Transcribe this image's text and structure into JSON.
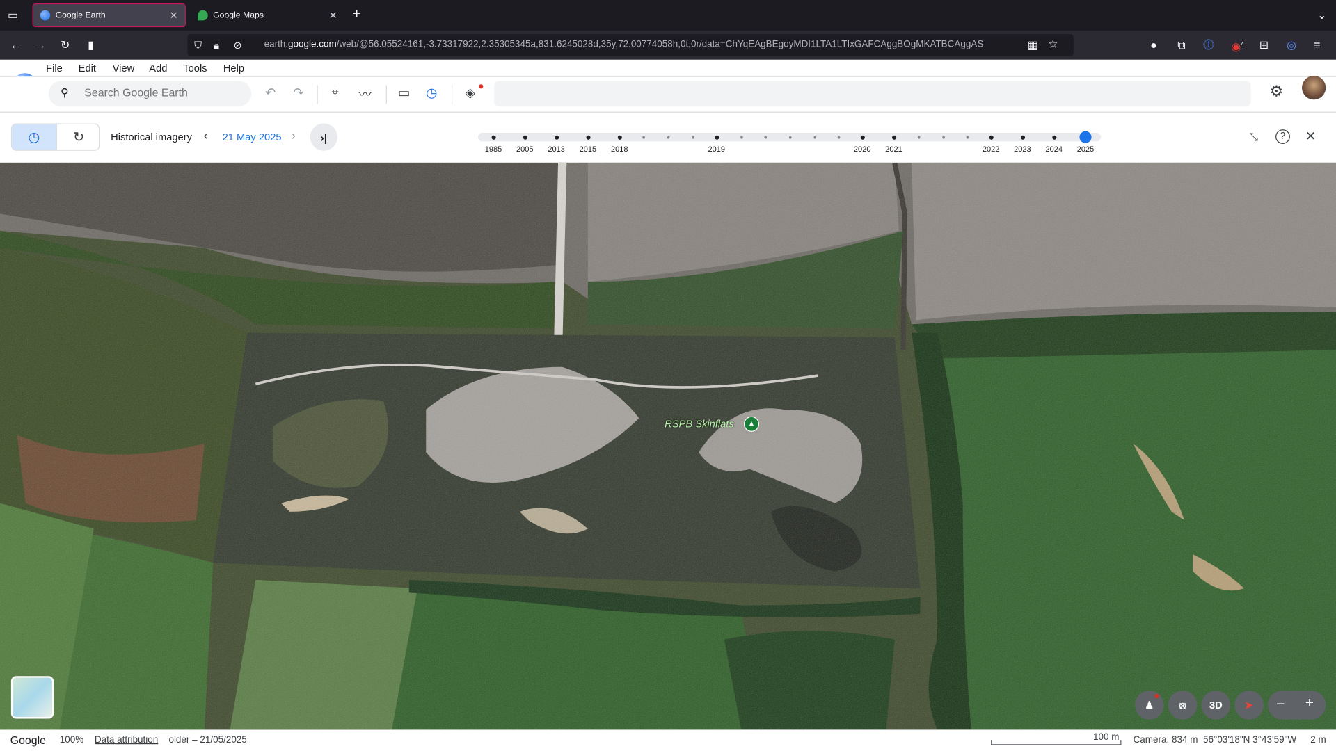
{
  "browser": {
    "tabs": [
      {
        "title": "Google Earth",
        "active": true
      },
      {
        "title": "Google Maps",
        "active": false
      }
    ],
    "url_prefix": "earth.",
    "url_domain": "google.com",
    "url_rest": "/web/@56.05524161,-3.73317922,2.35305345a,831.6245028d,35y,72.00774058h,0t,0r/data=ChYqEAgBEgoyMDI1LTA1LTIxGAFCAggBOgMKATBCAggAS",
    "badge_count": "4"
  },
  "menu": [
    "File",
    "Edit",
    "View",
    "Add",
    "Tools",
    "Help"
  ],
  "search": {
    "placeholder": "Search Google Earth"
  },
  "historical": {
    "label": "Historical imagery",
    "date": "21 May 2025",
    "years": [
      "1985",
      "2005",
      "2013",
      "2015",
      "2018",
      "2019",
      "2020",
      "2021",
      "2022",
      "2023",
      "2024",
      "2025"
    ],
    "selected_year": "2025"
  },
  "map": {
    "place_label": "RSPB Skinflats"
  },
  "controls": {
    "three_d": "3D"
  },
  "status": {
    "brand": "Google",
    "zoom": "100%",
    "attribution": "Data attribution",
    "imagery_date": "older – 21/05/2025",
    "scale": "100 m",
    "camera": "Camera: 834 m",
    "coords": "56°03'18\"N 3°43'59\"W",
    "elevation": "2 m"
  },
  "colors": {
    "accent": "#1a73e8",
    "tab_border": "#c2185b",
    "label_green": "#b7f5a8"
  }
}
